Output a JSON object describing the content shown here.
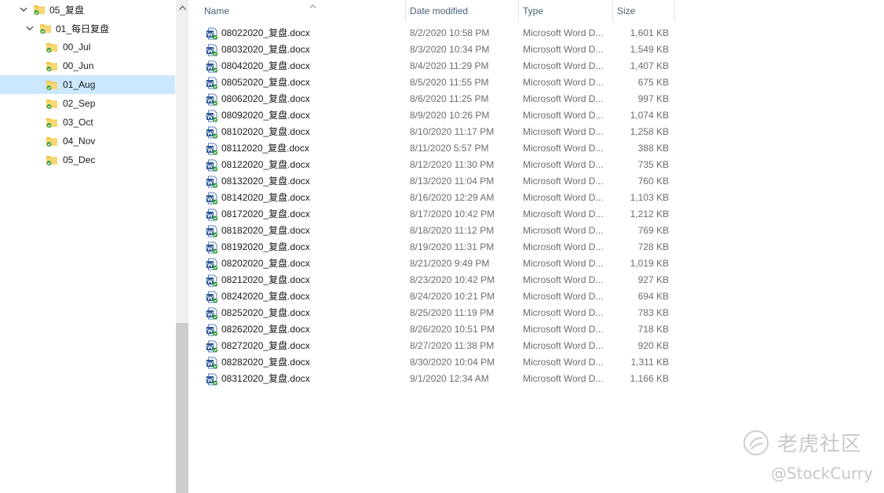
{
  "nav": {
    "items": [
      {
        "label": "05_复盘",
        "expanded": true,
        "selected": false
      },
      {
        "label": "01_每日复盘",
        "expanded": true,
        "selected": false
      },
      {
        "label": "00_Jul",
        "selected": false
      },
      {
        "label": "00_Jun",
        "selected": false
      },
      {
        "label": "01_Aug",
        "selected": true
      },
      {
        "label": "02_Sep",
        "selected": false
      },
      {
        "label": "03_Oct",
        "selected": false
      },
      {
        "label": "04_Nov",
        "selected": false
      },
      {
        "label": "05_Dec",
        "selected": false
      }
    ]
  },
  "columns": {
    "name": "Name",
    "date": "Date modified",
    "type": "Type",
    "size": "Size"
  },
  "files": [
    {
      "name": "08022020_复盘.docx",
      "date": "8/2/2020 10:58 PM",
      "type": "Microsoft Word D...",
      "size": "1,601 KB"
    },
    {
      "name": "08032020_复盘.docx",
      "date": "8/3/2020 10:34 PM",
      "type": "Microsoft Word D...",
      "size": "1,549 KB"
    },
    {
      "name": "08042020_复盘.docx",
      "date": "8/4/2020 11:29 PM",
      "type": "Microsoft Word D...",
      "size": "1,407 KB"
    },
    {
      "name": "08052020_复盘.docx",
      "date": "8/5/2020 11:55 PM",
      "type": "Microsoft Word D...",
      "size": "675 KB"
    },
    {
      "name": "08062020_复盘.docx",
      "date": "8/6/2020 11:25 PM",
      "type": "Microsoft Word D...",
      "size": "997 KB"
    },
    {
      "name": "08092020_复盘.docx",
      "date": "8/9/2020 10:26 PM",
      "type": "Microsoft Word D...",
      "size": "1,074 KB"
    },
    {
      "name": "08102020_复盘.docx",
      "date": "8/10/2020 11:17 PM",
      "type": "Microsoft Word D...",
      "size": "1,258 KB"
    },
    {
      "name": "08112020_复盘.docx",
      "date": "8/11/2020 5:57 PM",
      "type": "Microsoft Word D...",
      "size": "388 KB"
    },
    {
      "name": "08122020_复盘.docx",
      "date": "8/12/2020 11:30 PM",
      "type": "Microsoft Word D...",
      "size": "735 KB"
    },
    {
      "name": "08132020_复盘.docx",
      "date": "8/13/2020 11:04 PM",
      "type": "Microsoft Word D...",
      "size": "760 KB"
    },
    {
      "name": "08142020_复盘.docx",
      "date": "8/16/2020 12:29 AM",
      "type": "Microsoft Word D...",
      "size": "1,103 KB"
    },
    {
      "name": "08172020_复盘.docx",
      "date": "8/17/2020 10:42 PM",
      "type": "Microsoft Word D...",
      "size": "1,212 KB"
    },
    {
      "name": "08182020_复盘.docx",
      "date": "8/18/2020 11:12 PM",
      "type": "Microsoft Word D...",
      "size": "769 KB"
    },
    {
      "name": "08192020_复盘.docx",
      "date": "8/19/2020 11:31 PM",
      "type": "Microsoft Word D...",
      "size": "728 KB"
    },
    {
      "name": "08202020_复盘.docx",
      "date": "8/21/2020 9:49 PM",
      "type": "Microsoft Word D...",
      "size": "1,019 KB"
    },
    {
      "name": "08212020_复盘.docx",
      "date": "8/23/2020 10:42 PM",
      "type": "Microsoft Word D...",
      "size": "927 KB"
    },
    {
      "name": "08242020_复盘.docx",
      "date": "8/24/2020 10:21 PM",
      "type": "Microsoft Word D...",
      "size": "694 KB"
    },
    {
      "name": "08252020_复盘.docx",
      "date": "8/25/2020 11:19 PM",
      "type": "Microsoft Word D...",
      "size": "783 KB"
    },
    {
      "name": "08262020_复盘.docx",
      "date": "8/26/2020 10:51 PM",
      "type": "Microsoft Word D...",
      "size": "718 KB"
    },
    {
      "name": "08272020_复盘.docx",
      "date": "8/27/2020 11:38 PM",
      "type": "Microsoft Word D...",
      "size": "920 KB"
    },
    {
      "name": "08282020_复盘.docx",
      "date": "8/30/2020 10:04 PM",
      "type": "Microsoft Word D...",
      "size": "1,311 KB"
    },
    {
      "name": "08312020_复盘.docx",
      "date": "9/1/2020 12:34 AM",
      "type": "Microsoft Word D...",
      "size": "1,166 KB"
    }
  ],
  "watermark": {
    "brand": "老虎社区",
    "handle": "@StockCurry"
  },
  "colors": {
    "selection": "#cce8ff",
    "header_text": "#4c607a",
    "folder": "#f5c542",
    "sync_check": "#2e9e2e",
    "word_blue": "#2b579a"
  },
  "icons": {
    "folder": "folder-icon",
    "word_document": "word-doc-icon",
    "sync_status": "sync-check-icon",
    "expand": "chevron-down-icon",
    "sort": "sort-up-icon"
  }
}
